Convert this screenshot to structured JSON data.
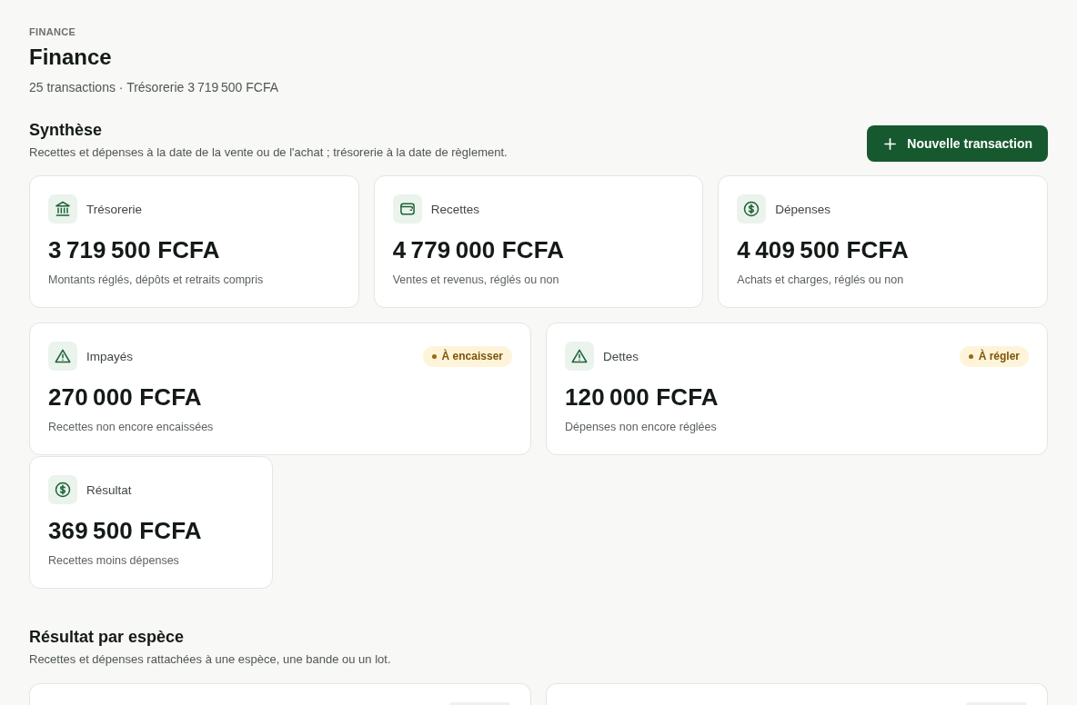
{
  "eyebrow": "FINANCE",
  "title": "Finance",
  "subtitle": "25 transactions · Trésorerie 3 719 500 FCFA",
  "summary": {
    "title": "Synthèse",
    "description": "Recettes et dépenses à la date de la vente ou de l'achat ; trésorerie à la date de règlement.",
    "action_button": {
      "label": "Nouvelle transaction"
    },
    "card_rows": [
      {
        "cards": [
          {
            "kind": "treasury",
            "label": "Trésorerie",
            "value": "3 719 500 FCFA",
            "description": "Montants réglés, dépôts et retraits compris"
          },
          {
            "kind": "income",
            "label": "Recettes",
            "value": "4 779 000 FCFA",
            "description": "Ventes et revenus, réglés ou non"
          },
          {
            "kind": "expense",
            "label": "Dépenses",
            "value": "4 409 500 FCFA",
            "description": "Achats et charges, réglés ou non"
          }
        ]
      },
      {
        "cards": [
          {
            "kind": "receivable",
            "label": "Impayés",
            "badge": "À encaisser",
            "value": "270 000 FCFA",
            "description": "Recettes non encore encaissées"
          },
          {
            "kind": "debt",
            "label": "Dettes",
            "badge": "À régler",
            "value": "120 000 FCFA",
            "description": "Dépenses non encore réglées"
          }
        ]
      },
      {
        "cards": [
          {
            "kind": "result",
            "label": "Résultat",
            "value": "369 500 FCFA",
            "description": "Recettes moins dépenses"
          }
        ]
      }
    ]
  },
  "species_results": {
    "title": "Résultat par espèce",
    "description": "Recettes et dépenses rattachées à une espèce, une bande ou un lot.",
    "cards": [
      {
        "badge": true
      },
      {
        "badge": true
      }
    ]
  }
}
